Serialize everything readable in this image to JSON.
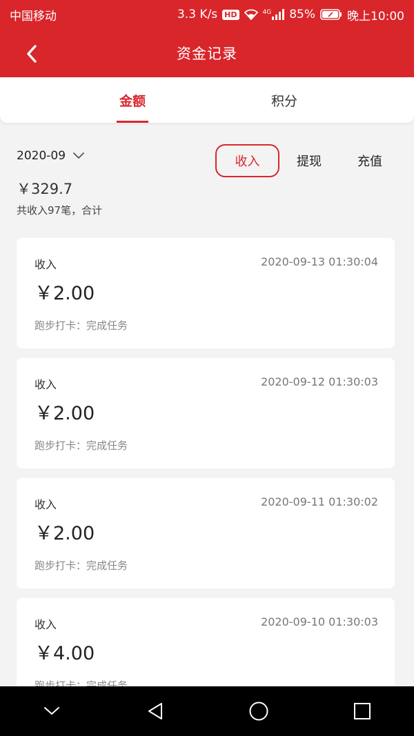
{
  "status_bar": {
    "carrier": "中国移动",
    "speed": "3.3 K/s",
    "hd": "HD",
    "network": "4G",
    "battery": "85%",
    "time": "晚上10:00"
  },
  "app_bar": {
    "title": "资金记录",
    "back_icon": "chevron-left-icon"
  },
  "tabs": [
    {
      "label": "金额",
      "active": true
    },
    {
      "label": "积分",
      "active": false
    }
  ],
  "filter": {
    "month": "2020-09",
    "month_icon": "chevron-down-icon",
    "types": [
      {
        "label": "收入",
        "active": true
      },
      {
        "label": "提现",
        "active": false
      },
      {
        "label": "充值",
        "active": false
      }
    ]
  },
  "summary": {
    "amount": "￥329.7",
    "text": "共收入97笔，合计"
  },
  "records": [
    {
      "type": "收入",
      "time": "2020-09-13 01:30:04",
      "amount": "￥2.00",
      "desc": "跑步打卡：完成任务"
    },
    {
      "type": "收入",
      "time": "2020-09-12 01:30:03",
      "amount": "￥2.00",
      "desc": "跑步打卡：完成任务"
    },
    {
      "type": "收入",
      "time": "2020-09-11 01:30:02",
      "amount": "￥2.00",
      "desc": "跑步打卡：完成任务"
    },
    {
      "type": "收入",
      "time": "2020-09-10 01:30:03",
      "amount": "￥4.00",
      "desc": "跑步打卡：完成任务"
    }
  ],
  "colors": {
    "brand": "#d9262b",
    "background": "#f3f3f3"
  },
  "nav_bar": {
    "icons": [
      "chevron-down-icon",
      "back-triangle-icon",
      "home-circle-icon",
      "recents-square-icon"
    ]
  }
}
